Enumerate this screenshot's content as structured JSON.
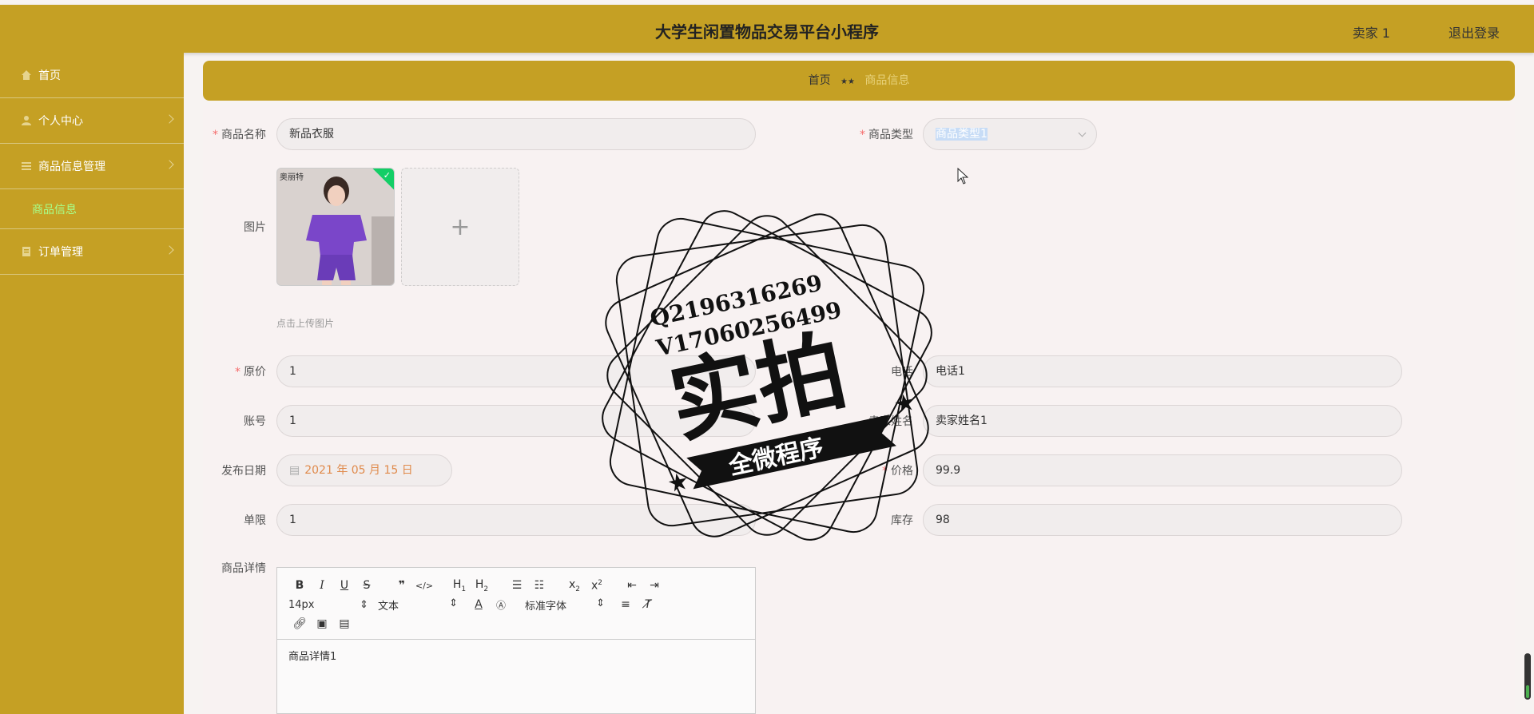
{
  "header": {
    "title": "大学生闲置物品交易平台小程序",
    "user": "卖家 1",
    "logout": "退出登录"
  },
  "sidebar": {
    "items": [
      {
        "label": "首页",
        "icon": "home-icon"
      },
      {
        "label": "个人中心",
        "icon": "user-icon"
      },
      {
        "label": "商品信息管理",
        "icon": "list-icon",
        "sub": [
          "商品信息"
        ]
      },
      {
        "label": "订单管理",
        "icon": "order-icon"
      }
    ]
  },
  "breadcrumb": {
    "home": "首页",
    "sep": "★★",
    "current": "商品信息"
  },
  "form": {
    "name_label": "商品名称",
    "name_value": "新品衣服",
    "type_label": "商品类型",
    "type_value": "商品类型1",
    "image_label": "图片",
    "image_watermark": "奥丽特",
    "upload_hint": "点击上传图片",
    "orig_price_label": "原价",
    "orig_price_value": "1",
    "phone_label": "电话",
    "phone_value": "电话1",
    "account_label": "账号",
    "account_value": "1",
    "seller_label": "卖家姓名",
    "seller_value": "卖家姓名1",
    "date_label": "发布日期",
    "date_value": "2021 年 05 月 15 日",
    "price_label": "价格",
    "price_value": "99.9",
    "limit_label": "单限",
    "limit_value": "1",
    "stock_label": "库存",
    "stock_value": "98",
    "detail_label": "商品详情"
  },
  "editor": {
    "font_size": "14px",
    "text_style": "文本",
    "font_family": "标准字体",
    "body": "商品详情1"
  },
  "stamp": {
    "line1": "Q2196316269",
    "line2": "V17060256499",
    "big": "实拍",
    "ribbon": "全微程序"
  },
  "colors": {
    "brand": "#c5a024",
    "active_sub": "#a8ff8a",
    "required": "#f56c6c",
    "date": "#e08a4b"
  }
}
